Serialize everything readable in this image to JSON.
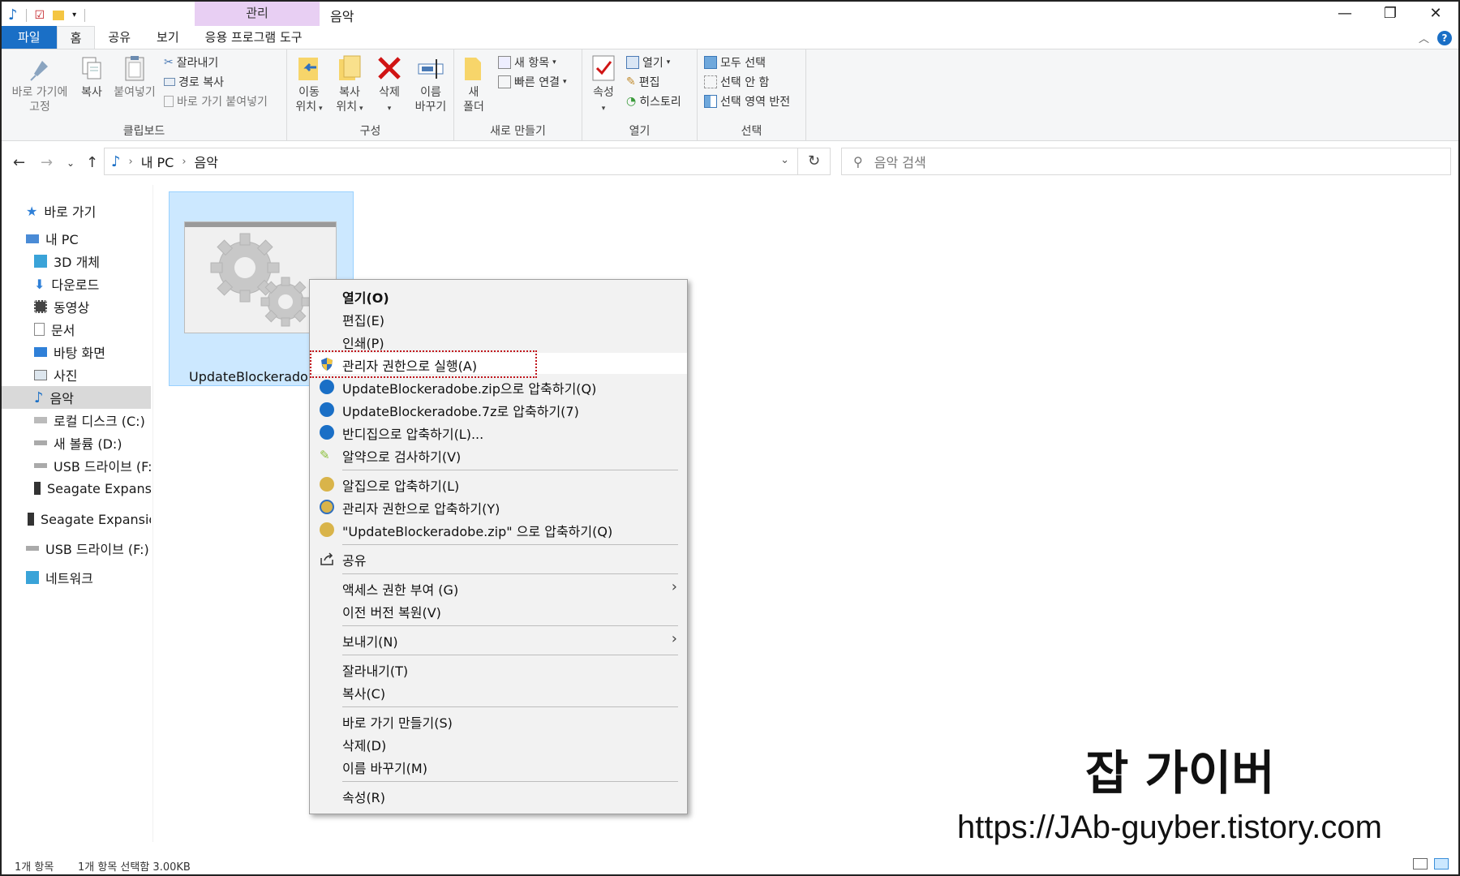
{
  "window": {
    "title": "음악",
    "context_tab": "관리",
    "controls": {
      "minimize": "—",
      "restore": "❐",
      "close": "✕"
    }
  },
  "tabs": [
    "파일",
    "홈",
    "공유",
    "보기",
    "응용 프로그램 도구"
  ],
  "ribbon": {
    "clipboard": {
      "label": "클립보드",
      "pin": "바로 가기에\n고정",
      "pin_line1": "바로 가기에",
      "pin_line2": "고정",
      "copy": "복사",
      "paste": "붙여넣기",
      "cut": "잘라내기",
      "copy_path": "경로 복사",
      "paste_shortcut": "바로 가기 붙여넣기"
    },
    "organize": {
      "label": "구성",
      "move_l1": "이동",
      "move_l2": "위치",
      "copy_l1": "복사",
      "copy_l2": "위치",
      "delete": "삭제",
      "rename_l1": "이름",
      "rename_l2": "바꾸기"
    },
    "new": {
      "label": "새로 만들기",
      "folder_l1": "새",
      "folder_l2": "폴더",
      "new_item": "새 항목",
      "easy_access": "빠른 연결"
    },
    "open": {
      "label": "열기",
      "properties": "속성",
      "open": "열기",
      "edit": "편집",
      "history": "히스토리"
    },
    "select": {
      "label": "선택",
      "select_all": "모두 선택",
      "select_none": "선택 안 함",
      "invert": "선택 영역 반전"
    }
  },
  "address": {
    "segments": [
      "내 PC",
      "음악"
    ],
    "search_placeholder": "음악 검색"
  },
  "nav": {
    "quick_access": "바로 가기",
    "this_pc": "내 PC",
    "items": [
      "3D 개체",
      "다운로드",
      "동영상",
      "문서",
      "바탕 화면",
      "사진",
      "음악",
      "로컬 디스크 (C:)",
      "새 볼륨 (D:)",
      "USB 드라이브 (F:)",
      "Seagate Expansio"
    ],
    "seagate": "Seagate Expansion",
    "usb": "USB 드라이브 (F:)",
    "network": "네트워크"
  },
  "file": {
    "name": "UpdateBlockeradobe"
  },
  "context_menu": {
    "items": [
      "열기(O)",
      "편집(E)",
      "인쇄(P)",
      "관리자 권한으로 실행(A)",
      "UpdateBlockeradobe.zip으로 압축하기(Q)",
      "UpdateBlockeradobe.7z로 압축하기(7)",
      "반디집으로 압축하기(L)...",
      "알약으로 검사하기(V)",
      "알집으로 압축하기(L)",
      "관리자 권한으로 압축하기(Y)",
      "\"UpdateBlockeradobe.zip\" 으로 압축하기(Q)",
      "공유",
      "액세스 권한 부여 (G)",
      "이전 버전 복원(V)",
      "보내기(N)",
      "잘라내기(T)",
      "복사(C)",
      "바로 가기 만들기(S)",
      "삭제(D)",
      "이름 바꾸기(M)",
      "속성(R)"
    ]
  },
  "watermark": {
    "title": "잡 가이버",
    "url": "https://JAb-guyber.tistory.com"
  },
  "status": {
    "count": "1개 항목",
    "selected": "1개 항목 선택함 3.00KB"
  },
  "colors": {
    "accent": "#1a6fc6",
    "manage_tab": "#e8cff3",
    "selection": "#cce8ff",
    "highlight_border": "#c0151b"
  }
}
